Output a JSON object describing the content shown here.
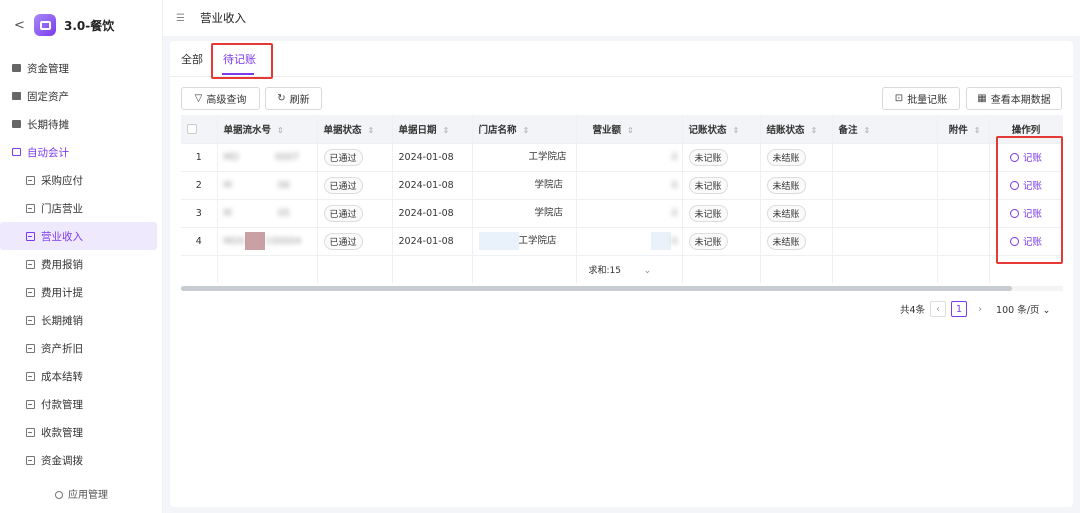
{
  "app": {
    "name": "3.0-餐饮",
    "back_glyph": "<"
  },
  "sidebar": {
    "groups": [
      {
        "label": "资金管理",
        "icon": "folder-icon"
      },
      {
        "label": "固定资产",
        "icon": "folder-icon"
      },
      {
        "label": "长期待摊",
        "icon": "folder-icon"
      },
      {
        "label": "自动会计",
        "icon": "folder-open-icon",
        "open": true
      }
    ],
    "items": [
      {
        "label": "采购应付"
      },
      {
        "label": "门店营业"
      },
      {
        "label": "营业收入",
        "active": true
      },
      {
        "label": "费用报销"
      },
      {
        "label": "费用计提"
      },
      {
        "label": "长期摊销"
      },
      {
        "label": "资产折旧"
      },
      {
        "label": "成本结转"
      },
      {
        "label": "付款管理"
      },
      {
        "label": "收款管理"
      },
      {
        "label": "资金调拨"
      }
    ],
    "footer": "应用管理"
  },
  "header": {
    "title": "营业收入"
  },
  "tabs": [
    {
      "label": "全部"
    },
    {
      "label": "待记账",
      "active": true
    }
  ],
  "toolbar": {
    "advanced_search": "高级查询",
    "refresh": "刷新",
    "batch_post": "批量记账",
    "view_period": "查看本期数据"
  },
  "table": {
    "columns": [
      "单据流水号",
      "单据状态",
      "单据日期",
      "门店名称",
      "营业额",
      "记账状态",
      "结账状态",
      "备注",
      "附件",
      "操作列"
    ],
    "rows": [
      {
        "no": "1",
        "serial_a": "MD",
        "serial_b": "0007",
        "status": "已通过",
        "date": "2024-01-08",
        "store": "工学院店",
        "amount": "0",
        "post_status": "未记账",
        "close_status": "未结账",
        "action": "记账"
      },
      {
        "no": "2",
        "serial_a": "M",
        "serial_b": "06",
        "status": "已通过",
        "date": "2024-01-08",
        "store": "学院店",
        "amount": "0",
        "post_status": "未记账",
        "close_status": "未结账",
        "action": "记账"
      },
      {
        "no": "3",
        "serial_a": "M",
        "serial_b": "05",
        "status": "已通过",
        "date": "2024-01-08",
        "store": "学院店",
        "amount": "0",
        "post_status": "未记账",
        "close_status": "未结账",
        "action": "记账"
      },
      {
        "no": "4",
        "serial_a": "MDS",
        "serial_b": "100004",
        "status": "已通过",
        "date": "2024-01-08",
        "store": "工学院店",
        "amount": "0",
        "post_status": "未记账",
        "close_status": "未结账",
        "action": "记账"
      }
    ],
    "sum_label": "求和:15"
  },
  "pagination": {
    "total": "共4条",
    "page": "1",
    "page_size": "100 条/页"
  },
  "colors": {
    "accent": "#7c3aed",
    "highlight": "#e53935"
  }
}
